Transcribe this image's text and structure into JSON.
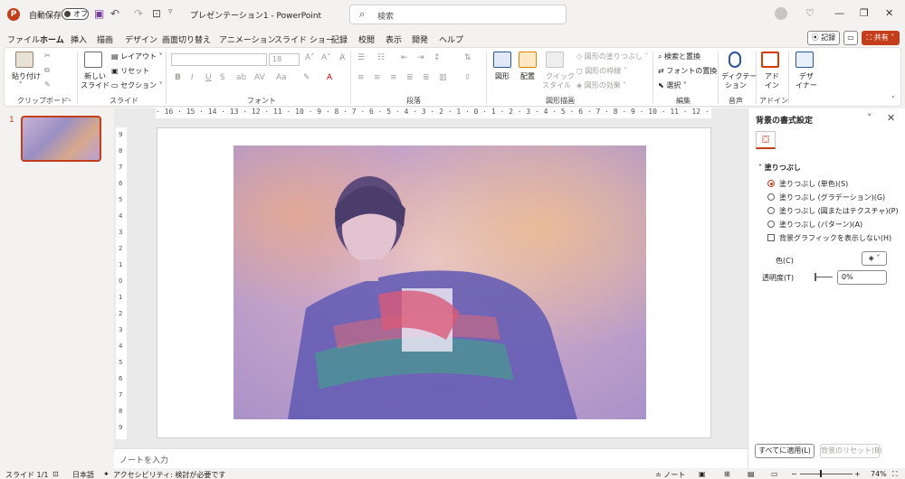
{
  "titlebar": {
    "autosave_label": "自動保存",
    "autosave_state": "オフ",
    "doc_title": "プレゼンテーション1  -  PowerPoint",
    "search_placeholder": "検索"
  },
  "menu": {
    "tabs": [
      "ファイル",
      "ホーム",
      "挿入",
      "描画",
      "デザイン",
      "画面切り替え",
      "アニメーション",
      "スライド ショー",
      "記録",
      "校閲",
      "表示",
      "開発",
      "ヘルプ"
    ],
    "active": "ホーム",
    "record_label": "記録",
    "share_label": "共有"
  },
  "ribbon": {
    "groups": {
      "clipboard": "クリップボード",
      "slides": "スライド",
      "font": "フォント",
      "paragraph": "段落",
      "drawing": "図形描画",
      "editing": "編集",
      "voice": "音声",
      "addins": "アドイン"
    },
    "paste": "貼り付け",
    "new_slide": "新しい",
    "new_slide2": "スライド",
    "layout": "レイアウト",
    "reset": "リセット",
    "section": "セクション",
    "font_size": "18",
    "shapes": "図形",
    "arrange": "配置",
    "quick_styles": "クイック",
    "quick_styles2": "スタイル",
    "shape_fill": "図形の塗りつぶし",
    "shape_outline": "図形の枠線",
    "shape_effects": "図形の効果",
    "find": "検索と置換",
    "replace_font": "フォントの置換",
    "select": "選択",
    "dictate": "ディクテー",
    "dictate2": "ション",
    "addin": "アド",
    "addin2": "イン",
    "designer": "デザ",
    "designer2": "イナー"
  },
  "ruler_h": "· 16 · 15 · 14 · 13 · 12 · 11 · 10 · 9 · 8 · 7 · 6 · 5 · 4 · 3 · 2 · 1 · 0 · 1 · 2 · 3 · 4 · 5 · 6 · 7 · 8 · 9 · 10 · 11 · 12 · 13 · 14 · 15 · 16",
  "ruler_v": [
    "9",
    "8",
    "7",
    "6",
    "5",
    "4",
    "3",
    "2",
    "1",
    "0",
    "1",
    "2",
    "3",
    "4",
    "5",
    "6",
    "7",
    "8",
    "9"
  ],
  "slide_number": "1",
  "notes_placeholder": "ノートを入力",
  "format_pane": {
    "title": "背景の書式設定",
    "section": "塗りつぶし",
    "options": [
      {
        "label": "塗りつぶし (単色)(S)",
        "selected": true
      },
      {
        "label": "塗りつぶし (グラデーション)(G)",
        "selected": false
      },
      {
        "label": "塗りつぶし (図またはテクスチャ)(P)",
        "selected": false
      },
      {
        "label": "塗りつぶし (パターン)(A)",
        "selected": false
      }
    ],
    "hide_graphics": "背景グラフィックを表示しない(H)",
    "color_label": "色(C)",
    "transparency_label": "透明度(T)",
    "transparency_value": "0%",
    "apply_all": "すべてに適用(L)",
    "reset_bg": "背景のリセット(B)"
  },
  "statusbar": {
    "slide_info": "スライド 1/1",
    "language": "日本語",
    "accessibility": "アクセシビリティ: 検討が必要です",
    "notes": "ノート",
    "zoom": "74%"
  },
  "colors": {
    "accent": "#c43e1c",
    "photo_tint": "#b8a8e0"
  }
}
